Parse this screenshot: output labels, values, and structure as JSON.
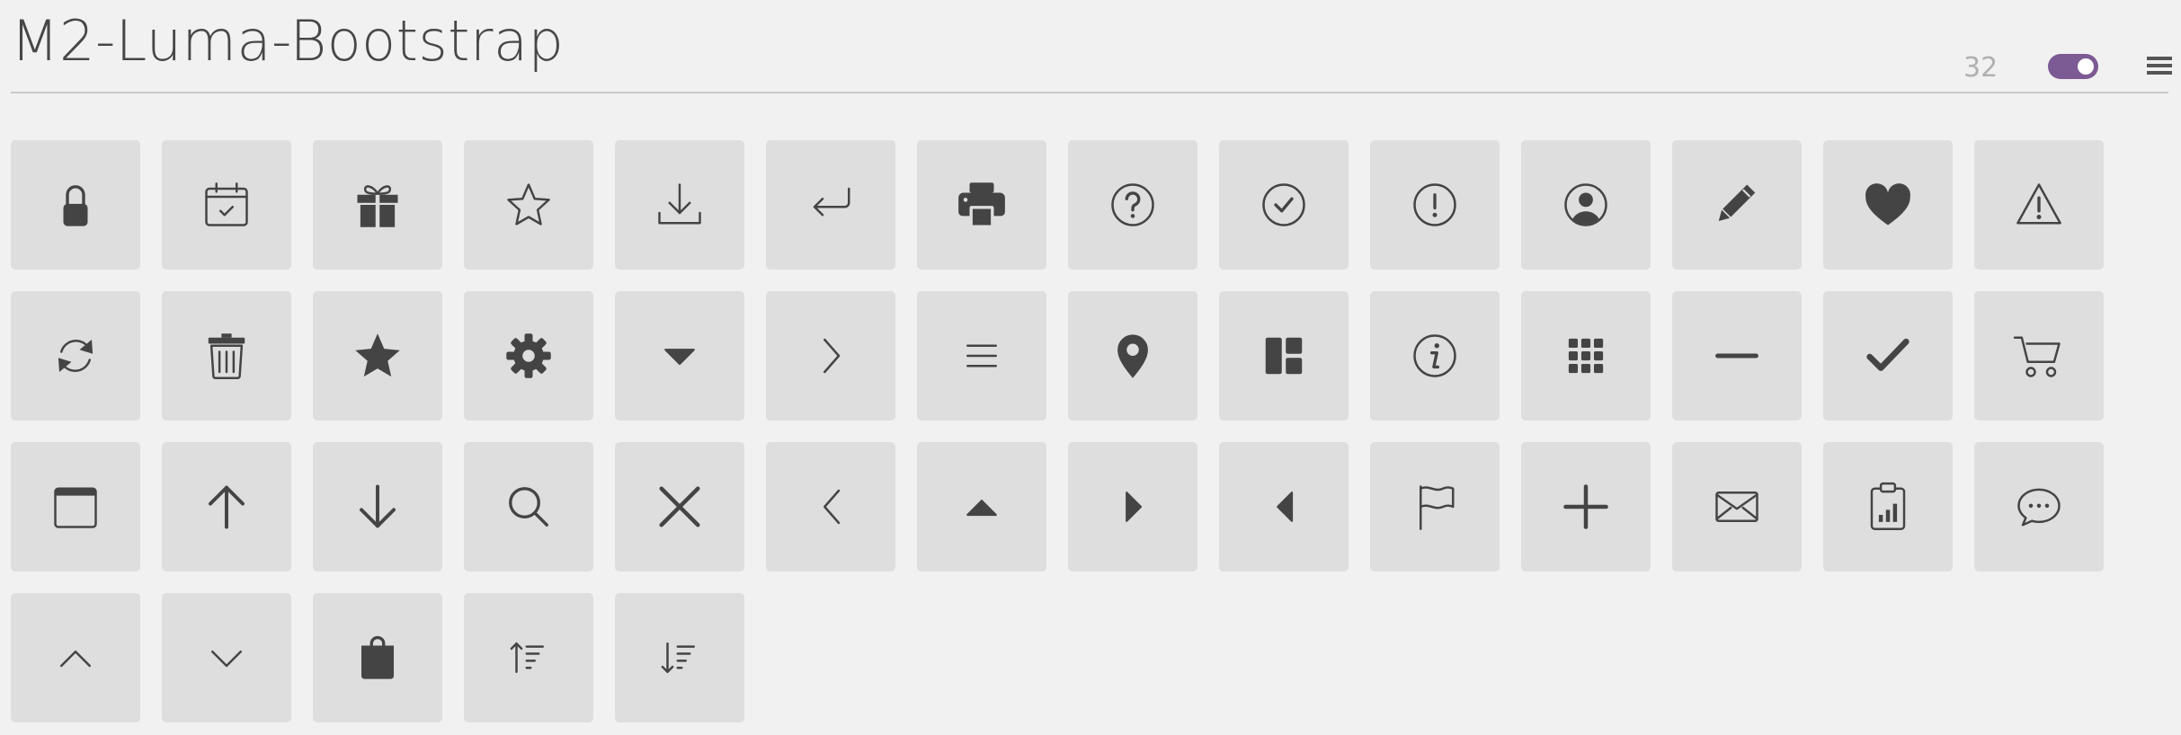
{
  "header": {
    "title": "M2-Luma-Bootstrap",
    "icon_count": "32"
  },
  "toggle": {
    "state": "on",
    "color": "#7c5a93"
  },
  "colors": {
    "icon": "#444444",
    "tile": "#dedede",
    "background": "#f1f1f1"
  },
  "icons": [
    {
      "name": "lock-icon"
    },
    {
      "name": "calendar-check-icon"
    },
    {
      "name": "gift-icon"
    },
    {
      "name": "star-outline-icon"
    },
    {
      "name": "download-icon"
    },
    {
      "name": "return-arrow-icon"
    },
    {
      "name": "printer-icon"
    },
    {
      "name": "question-circle-icon"
    },
    {
      "name": "check-circle-icon"
    },
    {
      "name": "exclamation-circle-icon"
    },
    {
      "name": "user-circle-icon"
    },
    {
      "name": "pencil-icon"
    },
    {
      "name": "heart-icon"
    },
    {
      "name": "warning-triangle-icon"
    },
    {
      "name": "refresh-icon"
    },
    {
      "name": "trash-icon"
    },
    {
      "name": "star-filled-icon"
    },
    {
      "name": "gear-icon"
    },
    {
      "name": "caret-down-icon"
    },
    {
      "name": "chevron-right-icon"
    },
    {
      "name": "menu-lines-icon"
    },
    {
      "name": "map-pin-icon"
    },
    {
      "name": "layout-grid-icon"
    },
    {
      "name": "info-circle-icon"
    },
    {
      "name": "apps-grid-icon"
    },
    {
      "name": "minus-icon"
    },
    {
      "name": "checkmark-icon"
    },
    {
      "name": "shopping-cart-icon"
    },
    {
      "name": "calendar-icon"
    },
    {
      "name": "arrow-up-icon"
    },
    {
      "name": "arrow-down-icon"
    },
    {
      "name": "search-icon"
    },
    {
      "name": "close-x-icon"
    },
    {
      "name": "chevron-left-icon"
    },
    {
      "name": "caret-up-icon"
    },
    {
      "name": "caret-right-icon"
    },
    {
      "name": "caret-left-icon"
    },
    {
      "name": "flag-icon"
    },
    {
      "name": "plus-icon"
    },
    {
      "name": "envelope-icon"
    },
    {
      "name": "clipboard-chart-icon"
    },
    {
      "name": "chat-bubble-icon"
    },
    {
      "name": "chevron-up-icon"
    },
    {
      "name": "chevron-down-icon"
    },
    {
      "name": "shopping-bag-icon"
    },
    {
      "name": "sort-ascending-icon"
    },
    {
      "name": "sort-descending-icon"
    }
  ]
}
